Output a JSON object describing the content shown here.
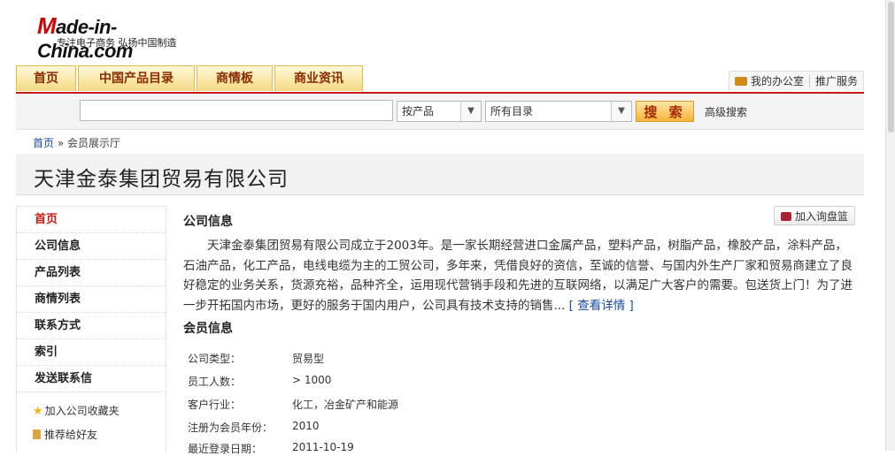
{
  "logo": {
    "text": "ade-in-China.com",
    "initial": "M",
    "slogan": "专注电子商务 弘扬中国制造"
  },
  "nav": {
    "tabs": [
      "首页",
      "中国产品目录",
      "商情板",
      "商业资讯"
    ],
    "office": "我的办公室",
    "promo": "推广服务"
  },
  "search": {
    "query": "",
    "type_select": "按产品",
    "category_select": "所有目录",
    "button": "搜 索",
    "advanced": "高级搜索"
  },
  "breadcrumb": {
    "home": "首页",
    "sep": " » ",
    "current": "会员展示厅"
  },
  "company": {
    "name": "天津金泰集团贸易有限公司"
  },
  "sidebar": {
    "items": [
      "首页",
      "公司信息",
      "产品列表",
      "商情列表",
      "联系方式",
      "索引",
      "发送联系信"
    ],
    "favorite": "加入公司收藏夹",
    "recommend": "推荐给好友"
  },
  "main": {
    "company_info_title": "公司信息",
    "basket_button": "加入询盘篮",
    "description": "天津金泰集团贸易有限公司成立于2003年。是一家长期经营进口金属产品，塑料产品，树脂产品，橡胶产品，涂料产品，石油产品，化工产品，电线电缆为主的工贸公司，多年来，凭借良好的资信，至诚的信誉、与国内外生产厂家和贸易商建立了良好稳定的业务关系，货源充裕，品种齐全，运用现代营销手段和先进的互联网络，以满足广大客户的需要。包送货上门！为了进一步开拓国内市场，更好的服务于国内用户，公司具有技术支持的销售... ",
    "more_link": "[ 查看详情 ]",
    "member_info_title": "会员信息",
    "member_rows": [
      {
        "label": "公司类型：",
        "value": "贸易型"
      },
      {
        "label": "员工人数：",
        "value": "> 1000"
      },
      {
        "label": "客户行业：",
        "value": "化工，冶金矿产和能源"
      },
      {
        "label": "注册为会员年份：",
        "value": "2010"
      },
      {
        "label": "最近登录日期：",
        "value": "2011-10-19"
      }
    ]
  }
}
